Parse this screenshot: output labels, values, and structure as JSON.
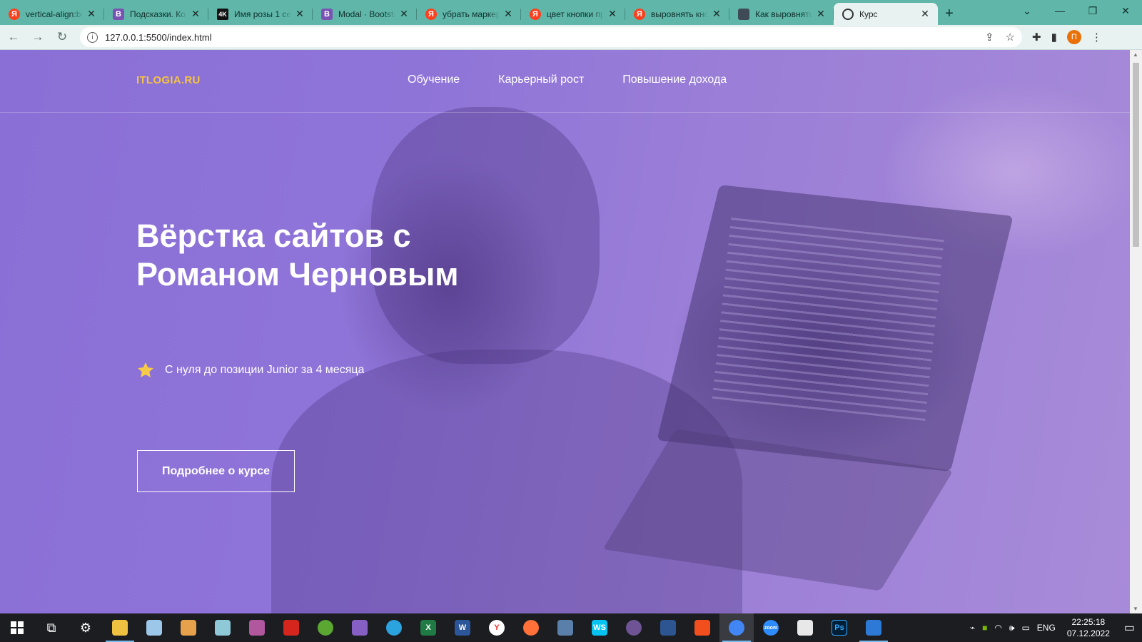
{
  "browser": {
    "tabs": [
      {
        "title": "vertical-align:bo",
        "favicon": "yandex-icon",
        "favicon_text": "Я",
        "active": false
      },
      {
        "title": "Подсказки. Ко",
        "favicon": "bootstrap-icon",
        "favicon_text": "B",
        "active": false
      },
      {
        "title": "Имя розы 1 се",
        "favicon": "4k-icon",
        "favicon_text": "4K",
        "active": false
      },
      {
        "title": "Modal · Bootstr",
        "favicon": "bootstrap-icon",
        "favicon_text": "B",
        "active": false
      },
      {
        "title": "убрать маркер",
        "favicon": "yandex-icon",
        "favicon_text": "Я",
        "active": false
      },
      {
        "title": "цвет кнопки пр",
        "favicon": "yandex-icon",
        "favicon_text": "Я",
        "active": false
      },
      {
        "title": "выровнять кно",
        "favicon": "yandex-icon",
        "favicon_text": "Я",
        "active": false
      },
      {
        "title": "Как выровнять",
        "favicon": "image-icon",
        "favicon_text": "",
        "active": false
      },
      {
        "title": "Курс",
        "favicon": "globe-icon",
        "favicon_text": "",
        "active": true
      }
    ],
    "url": "127.0.0.1:5500/index.html",
    "profile_initial": "П",
    "colors": {
      "tabbar": "#5fb6a9",
      "toolbar": "#e8f3f1"
    }
  },
  "site": {
    "logo": "ITLOGIA.RU",
    "nav": [
      "Обучение",
      "Карьерный рост",
      "Повышение дохода"
    ],
    "hero_title_line1": "Вёрстка сайтов с",
    "hero_title_line2": "Романом Черновым",
    "feature_text": "С нуля до позиции Junior за 4 месяца",
    "cta_label": "Подробнее о курсе",
    "colors": {
      "logo": "#f5c344",
      "overlay": "#8a6fd6",
      "text": "#ffffff"
    }
  },
  "taskbar": {
    "apps": [
      {
        "name": "task-view-icon",
        "text": ""
      },
      {
        "name": "settings-icon",
        "text": ""
      },
      {
        "name": "file-explorer-icon",
        "text": ""
      },
      {
        "name": "notepad-icon",
        "text": ""
      },
      {
        "name": "paint-icon",
        "text": ""
      },
      {
        "name": "notes-icon",
        "text": ""
      },
      {
        "name": "winrar-icon",
        "text": ""
      },
      {
        "name": "acrobat-icon",
        "text": ""
      },
      {
        "name": "utorrent-icon",
        "text": ""
      },
      {
        "name": "visual-studio-icon",
        "text": ""
      },
      {
        "name": "telegram-icon",
        "text": ""
      },
      {
        "name": "excel-icon",
        "text": "X"
      },
      {
        "name": "word-icon",
        "text": "W"
      },
      {
        "name": "yandex-browser-icon",
        "text": "Y"
      },
      {
        "name": "firefox-icon",
        "text": ""
      },
      {
        "name": "remote-desktop-icon",
        "text": ""
      },
      {
        "name": "webstorm-icon",
        "text": "WS"
      },
      {
        "name": "github-icon",
        "text": ""
      },
      {
        "name": "powershell-icon",
        "text": ""
      },
      {
        "name": "figma-icon",
        "text": ""
      },
      {
        "name": "chrome-icon",
        "text": ""
      },
      {
        "name": "zoom-icon",
        "text": "zoom"
      },
      {
        "name": "slack-icon",
        "text": ""
      },
      {
        "name": "photoshop-icon",
        "text": "Ps"
      },
      {
        "name": "vscode-icon",
        "text": ""
      }
    ],
    "language": "ENG",
    "time": "22:25:18",
    "date": "07.12.2022"
  }
}
